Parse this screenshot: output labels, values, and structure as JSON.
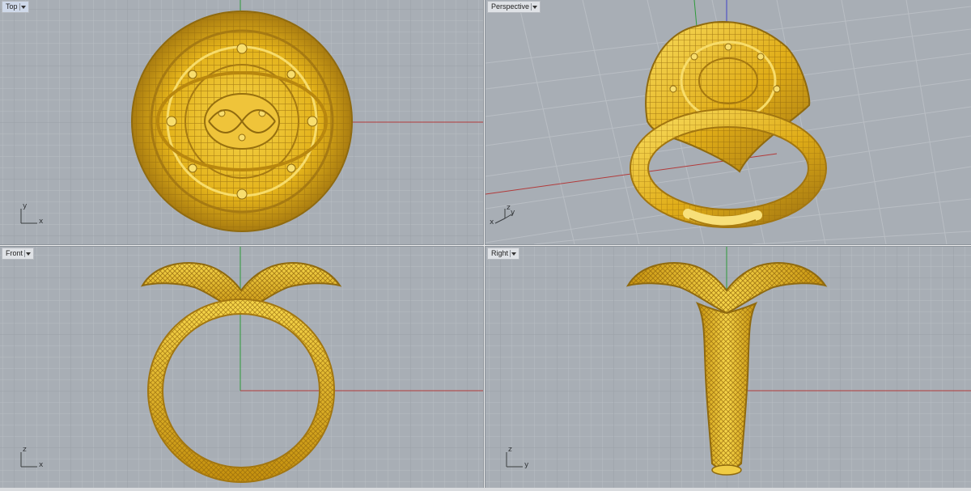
{
  "viewports": [
    {
      "id": "top",
      "title": "Top",
      "active": true,
      "axis_a": "y",
      "axis_b": "x"
    },
    {
      "id": "perspective",
      "title": "Perspective",
      "active": false,
      "axis_a": "z",
      "axis_b": "y",
      "axis_c": "x"
    },
    {
      "id": "front",
      "title": "Front",
      "active": false,
      "axis_a": "z",
      "axis_b": "x"
    },
    {
      "id": "right",
      "title": "Right",
      "active": false,
      "axis_a": "z",
      "axis_b": "y"
    }
  ],
  "colors": {
    "viewport_bg": "#a8aeb5",
    "grid_minor": "#b9bec4",
    "grid_major": "#8f959c",
    "axis_x": "#b23a3a",
    "axis_y": "#2e9a3a",
    "axis_z": "#3f43c8",
    "gold": "#e8b81c",
    "gold_dark": "#9c7210",
    "gold_light": "#f9e07a"
  },
  "icons": {
    "dropdown": "chevron-down-icon",
    "world_axes": "world-axes-icon"
  }
}
